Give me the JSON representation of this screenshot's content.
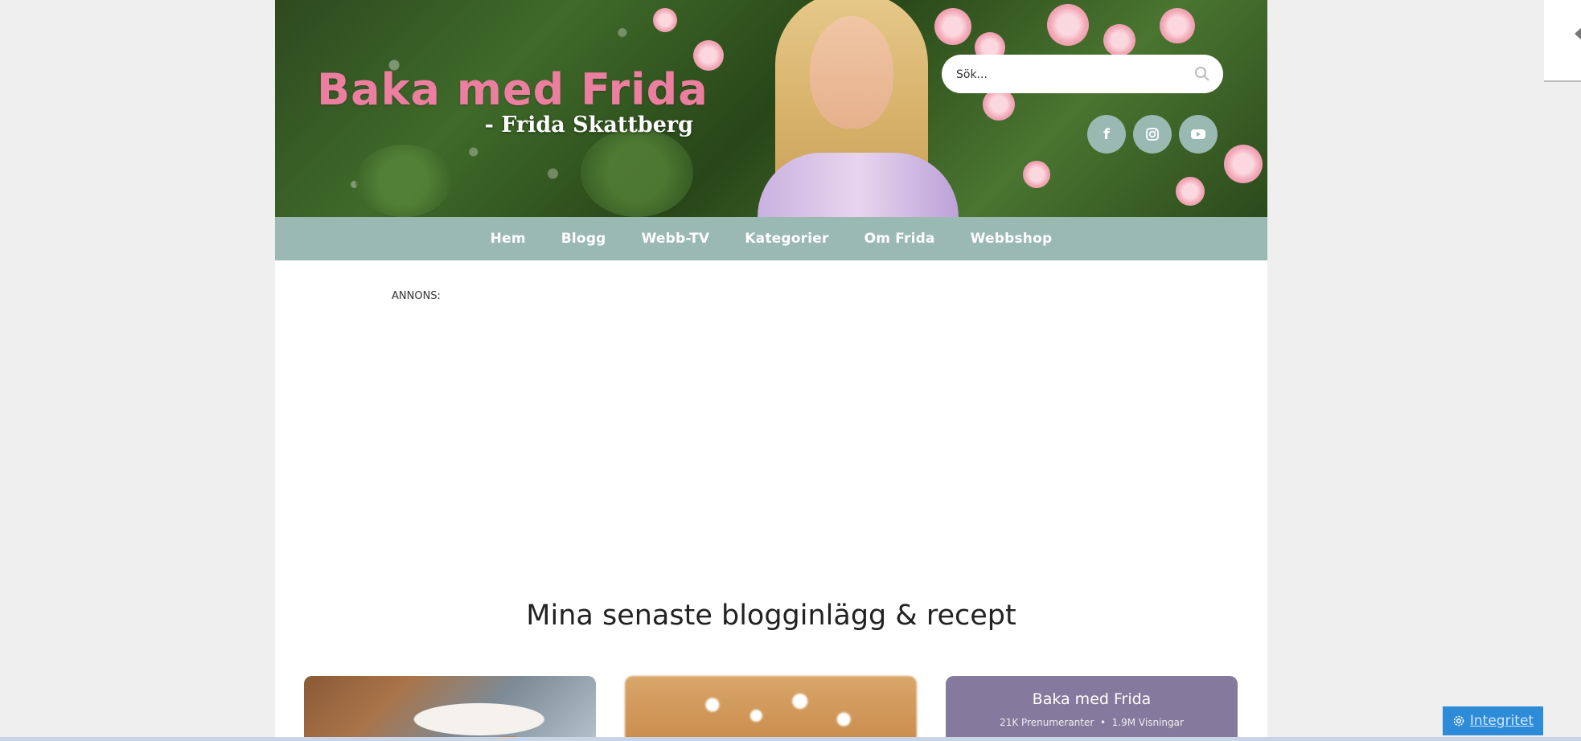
{
  "site": {
    "title": "Baka med Frida",
    "subtitle": "- Frida Skattberg"
  },
  "search": {
    "placeholder": "Sök..."
  },
  "social": {
    "facebook_icon": "f",
    "instagram_icon": "instagram-icon",
    "youtube_icon": "youtube-icon"
  },
  "nav": {
    "items": [
      "Hem",
      "Blogg",
      "Webb-TV",
      "Kategorier",
      "Om Frida",
      "Webbshop"
    ]
  },
  "ad": {
    "label": "ANNONS:"
  },
  "latest": {
    "heading": "Mina senaste blogginlägg & recept"
  },
  "youtube_card": {
    "title": "Baka med Frida",
    "subscribers": "21K Prenumeranter",
    "separator": "•",
    "views": "1.9M Visningar"
  },
  "privacy": {
    "label": "Integritet"
  },
  "colors": {
    "brand_pink": "#ec7fa0",
    "nav_teal": "#9bb9b3",
    "card_purple": "#857a9d",
    "privacy_blue": "#2e8bd8"
  }
}
